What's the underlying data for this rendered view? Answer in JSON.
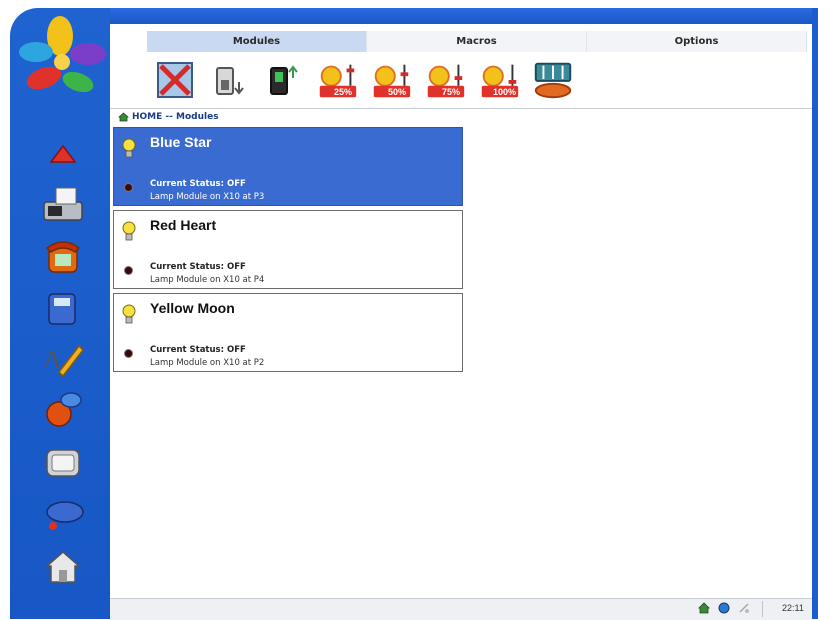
{
  "tabs": [
    {
      "label": "Modules",
      "active": true
    },
    {
      "label": "Macros",
      "active": false
    },
    {
      "label": "Options",
      "active": false
    }
  ],
  "toolbar": {
    "buttons": [
      {
        "name": "all-off-icon"
      },
      {
        "name": "module-off-icon"
      },
      {
        "name": "module-on-icon"
      },
      {
        "name": "dim-25-icon",
        "label": "25%"
      },
      {
        "name": "dim-50-icon",
        "label": "50%"
      },
      {
        "name": "dim-75-icon",
        "label": "75%"
      },
      {
        "name": "dim-100-icon",
        "label": "100%"
      },
      {
        "name": "mixer-icon"
      }
    ]
  },
  "breadcrumb": "HOME -- Modules",
  "modules": [
    {
      "name": "Blue Star",
      "status": "Current Status: OFF",
      "description": "Lamp Module on X10 at P3",
      "selected": true
    },
    {
      "name": "Red Heart",
      "status": "Current Status: OFF",
      "description": "Lamp Module on X10 at P4",
      "selected": false
    },
    {
      "name": "Yellow Moon",
      "status": "Current Status: OFF",
      "description": "Lamp Module on X10 at P2",
      "selected": false
    }
  ],
  "sidebar_icons": [
    "up-arrow-icon",
    "fax-icon",
    "phone-icon",
    "cordless-phone-icon",
    "edit-text-icon",
    "speech-icon",
    "tv-icon",
    "music-icon",
    "house-icon"
  ],
  "statusbar": {
    "clock": "22:11"
  },
  "colors": {
    "frame_blue": "#1d5ccc",
    "selected_card": "#3a6bd0",
    "active_tab": "#c9d9f2"
  }
}
